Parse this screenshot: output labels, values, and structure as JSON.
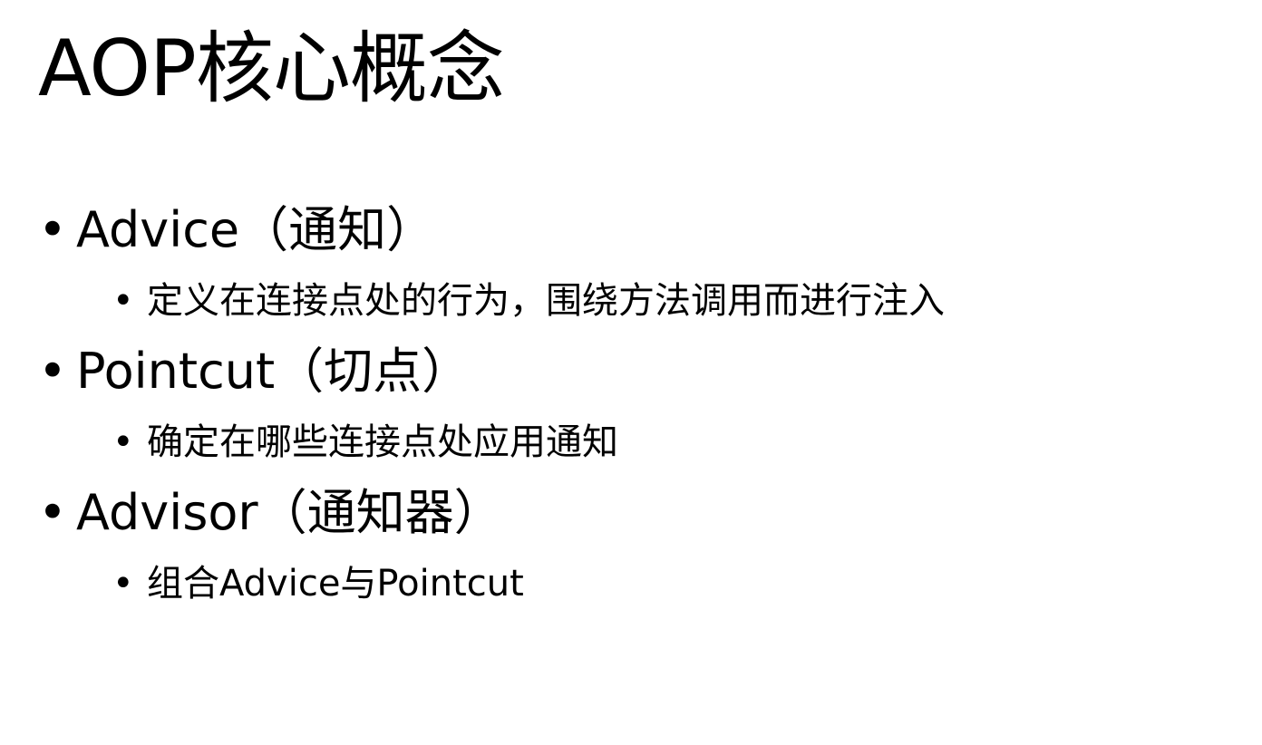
{
  "slide": {
    "title": "AOP核心概念",
    "bullet_char": "•",
    "items": [
      {
        "level": 1,
        "text": "Advice（通知）"
      },
      {
        "level": 2,
        "text": "定义在连接点处的行为，围绕方法调用而进行注入"
      },
      {
        "level": 1,
        "text": "Pointcut（切点）"
      },
      {
        "level": 2,
        "text": "确定在哪些连接点处应用通知"
      },
      {
        "level": 1,
        "text": "Advisor（通知器）"
      },
      {
        "level": 2,
        "text": "组合Advice与Pointcut"
      }
    ]
  }
}
